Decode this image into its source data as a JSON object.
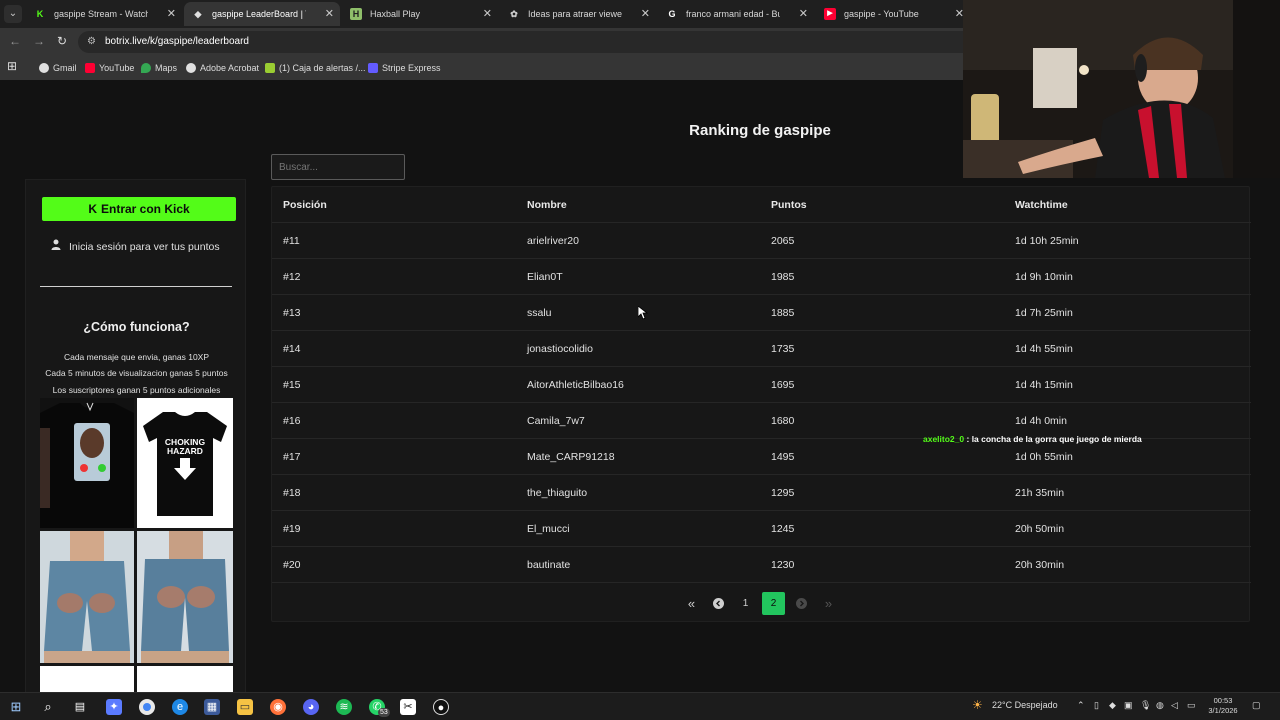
{
  "browser": {
    "tabs": [
      {
        "title": "gaspipe Stream - Watch Live on Kick",
        "icon": "kick-icon",
        "icon_color": "#53fc18"
      },
      {
        "title": "gaspipe LeaderBoard | The best",
        "icon": "botrix-icon",
        "icon_color": "#e0e0e0"
      },
      {
        "title": "Haxball Play",
        "icon": "haxball-icon",
        "icon_color": "#8fbf6a"
      },
      {
        "title": "Ideas para atraer viewers",
        "icon": "chatgpt-icon",
        "icon_color": "#cccccc"
      },
      {
        "title": "franco armani edad - Buscar con Google",
        "icon": "google-icon",
        "icon_color": "#ffffff"
      },
      {
        "title": "gaspipe - YouTube",
        "icon": "youtube-icon",
        "icon_color": "#ff0033"
      }
    ],
    "url": "botrix.live/k/gaspipe/leaderboard",
    "bookmarks": [
      {
        "label": "Gmail",
        "icon": "gmail-icon"
      },
      {
        "label": "YouTube",
        "icon": "youtube-icon"
      },
      {
        "label": "Maps",
        "icon": "maps-icon"
      },
      {
        "label": "Adobe Acrobat",
        "icon": "acrobat-icon"
      },
      {
        "label": "(1) Caja de alertas /...",
        "icon": "alerts-icon"
      },
      {
        "label": "Stripe Express",
        "icon": "stripe-icon"
      }
    ]
  },
  "page": {
    "title": "Ranking de gaspipe",
    "search_placeholder": "Buscar...",
    "sidebar": {
      "kick_button": "Entrar con Kick",
      "login_text": "Inicia sesión para ver tus puntos",
      "how_title": "¿Cómo funciona?",
      "how_lines": [
        "Cada mensaje que envia, ganas 10XP",
        "Cada 5 minutos de visualizacion ganas 5 puntos",
        "Los suscriptores ganan 5 puntos adicionales"
      ],
      "merch_shirt_text_1": "CHOKING",
      "merch_shirt_text_2": "HAZARD"
    },
    "table": {
      "headers": [
        "Posición",
        "Nombre",
        "Puntos",
        "Watchtime"
      ],
      "rows": [
        {
          "pos": "#11",
          "name": "arielriver20",
          "points": "2065",
          "watchtime": "1d 10h 25min"
        },
        {
          "pos": "#12",
          "name": "Elian0T",
          "points": "1985",
          "watchtime": "1d 9h 10min"
        },
        {
          "pos": "#13",
          "name": "ssalu",
          "points": "1885",
          "watchtime": "1d 7h 25min"
        },
        {
          "pos": "#14",
          "name": "jonastiocolidio",
          "points": "1735",
          "watchtime": "1d 4h 55min"
        },
        {
          "pos": "#15",
          "name": "AitorAthleticBilbao16",
          "points": "1695",
          "watchtime": "1d 4h 15min"
        },
        {
          "pos": "#16",
          "name": "Camila_7w7",
          "points": "1680",
          "watchtime": "1d 4h 0min"
        },
        {
          "pos": "#17",
          "name": "Mate_CARP91218",
          "points": "1495",
          "watchtime": "1d 0h 55min"
        },
        {
          "pos": "#18",
          "name": "the_thiaguito",
          "points": "1295",
          "watchtime": "21h 35min"
        },
        {
          "pos": "#19",
          "name": "El_mucci",
          "points": "1245",
          "watchtime": "20h 50min"
        },
        {
          "pos": "#20",
          "name": "bautinate",
          "points": "1230",
          "watchtime": "20h 30min"
        }
      ]
    },
    "pagination": {
      "first": "«",
      "prev": "‹",
      "pages": [
        "1",
        "2"
      ],
      "current": "2",
      "next": "›",
      "last": "»"
    },
    "chat_overlay": {
      "user": "axelito2_0",
      "message": ": la concha de la gorra que juego de mierda"
    }
  },
  "taskbar": {
    "weather": "22°C  Despejado",
    "whatsapp_badge": "53",
    "time": "00:53",
    "date": "3/1/2026"
  },
  "colors": {
    "kick_green": "#53fc18",
    "page_bg": "#121212",
    "card_bg": "#171717",
    "active_page": "#22c55e"
  }
}
